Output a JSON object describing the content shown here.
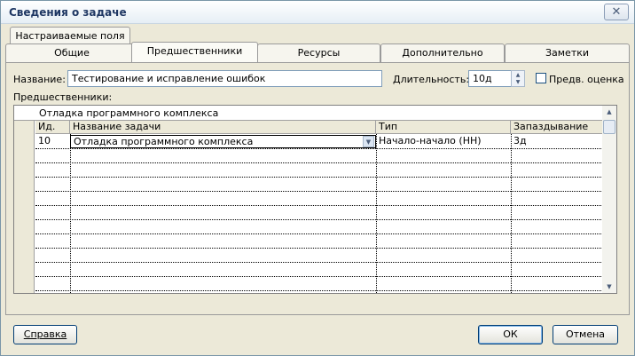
{
  "window": {
    "title": "Сведения о задаче",
    "close_icon": "✕"
  },
  "tabs": {
    "back_row": [
      {
        "label": "Настраиваемые поля"
      }
    ],
    "front_row": [
      {
        "label": "Общие"
      },
      {
        "label": "Предшественники"
      },
      {
        "label": "Ресурсы"
      },
      {
        "label": "Дополнительно"
      },
      {
        "label": "Заметки"
      }
    ]
  },
  "form": {
    "name_label": "Название:",
    "name_value": "Тестирование и исправление ошибок",
    "duration_label": "Длительность:",
    "duration_value": "10д",
    "estimate_label": "Предв. оценка",
    "predecessors_label": "Предшественники:"
  },
  "grid": {
    "edit_value": "Отладка программного комплекса",
    "columns": {
      "id": "Ид.",
      "name": "Название задачи",
      "type": "Тип",
      "lag": "Запаздывание"
    },
    "rows": [
      {
        "id": "10",
        "name": "Отладка программного комплекса",
        "type": "Начало-начало (НН)",
        "lag": "3д"
      }
    ]
  },
  "buttons": {
    "help": "Справка",
    "ok": "ОК",
    "cancel": "Отмена"
  }
}
